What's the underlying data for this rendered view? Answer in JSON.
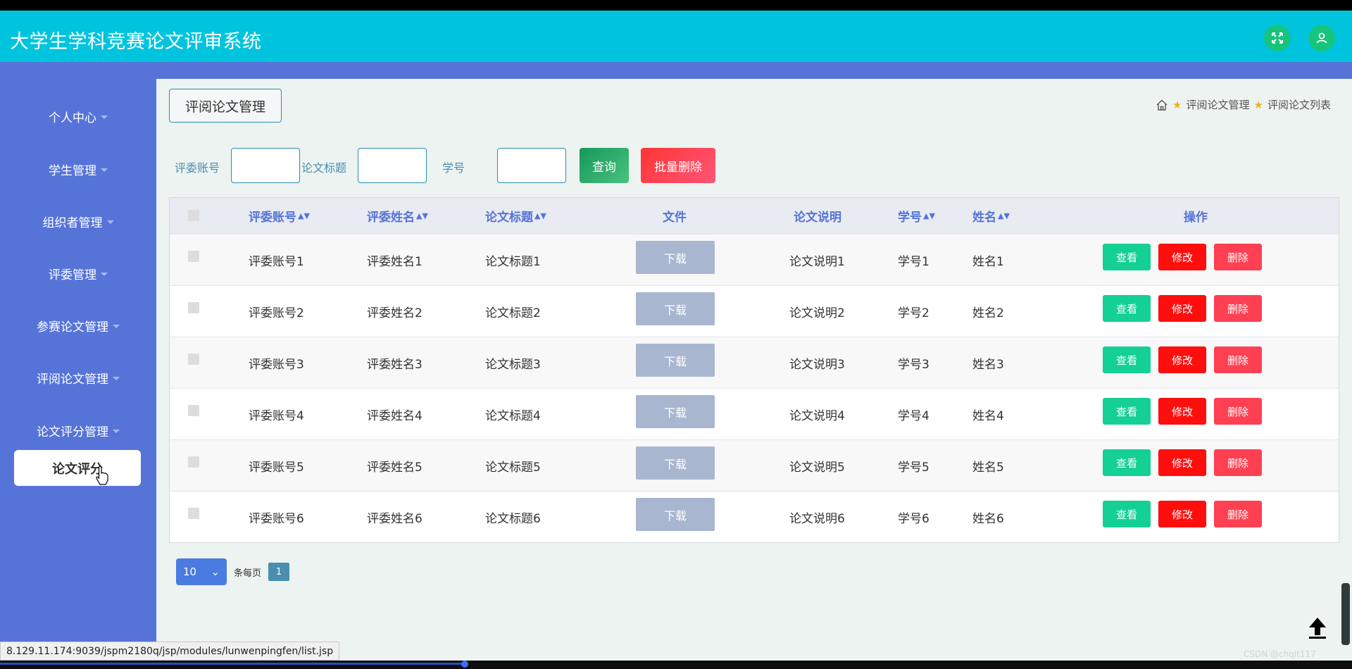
{
  "header": {
    "title": "大学生学科竞赛论文评审系统",
    "fullscreen_icon": "fullscreen-icon",
    "user_icon": "user-icon",
    "accent": "#00c4de"
  },
  "sidebar": {
    "items": [
      {
        "label": "个人中心"
      },
      {
        "label": "学生管理"
      },
      {
        "label": "组织者管理"
      },
      {
        "label": "评委管理"
      },
      {
        "label": "参赛论文管理"
      },
      {
        "label": "评阅论文管理"
      },
      {
        "label": "论文评分管理"
      }
    ],
    "active_item": "论文评分"
  },
  "page": {
    "title": "评阅论文管理",
    "breadcrumb": [
      "评阅论文管理",
      "评阅论文列表"
    ]
  },
  "search": {
    "field1_label": "评委账号",
    "field2_label": "论文标题",
    "field3_label": "学号",
    "query_label": "查询",
    "batch_delete_label": "批量删除"
  },
  "table": {
    "headers": {
      "account": "评委账号",
      "judge_name": "评委姓名",
      "paper_title": "论文标题",
      "file": "文件",
      "description": "论文说明",
      "student_id": "学号",
      "name": "姓名",
      "actions": "操作"
    },
    "download_label": "下载",
    "view_label": "查看",
    "edit_label": "修改",
    "delete_label": "删除",
    "rows": [
      {
        "account": "评委账号1",
        "judge_name": "评委姓名1",
        "paper_title": "论文标题1",
        "description": "论文说明1",
        "student_id": "学号1",
        "name": "姓名1"
      },
      {
        "account": "评委账号2",
        "judge_name": "评委姓名2",
        "paper_title": "论文标题2",
        "description": "论文说明2",
        "student_id": "学号2",
        "name": "姓名2"
      },
      {
        "account": "评委账号3",
        "judge_name": "评委姓名3",
        "paper_title": "论文标题3",
        "description": "论文说明3",
        "student_id": "学号3",
        "name": "姓名3"
      },
      {
        "account": "评委账号4",
        "judge_name": "评委姓名4",
        "paper_title": "论文标题4",
        "description": "论文说明4",
        "student_id": "学号4",
        "name": "姓名4"
      },
      {
        "account": "评委账号5",
        "judge_name": "评委姓名5",
        "paper_title": "论文标题5",
        "description": "论文说明5",
        "student_id": "学号5",
        "name": "姓名5"
      },
      {
        "account": "评委账号6",
        "judge_name": "评委姓名6",
        "paper_title": "论文标题6",
        "description": "论文说明6",
        "student_id": "学号6",
        "name": "姓名6"
      }
    ]
  },
  "pagination": {
    "page_size": "10",
    "per_page_label": "条每页",
    "current_page": "1"
  },
  "status_url": "8.129.11.174:9039/jspm2180q/jsp/modules/lunwenpingfen/list.jsp",
  "watermark": "CSDN @chqlt117"
}
